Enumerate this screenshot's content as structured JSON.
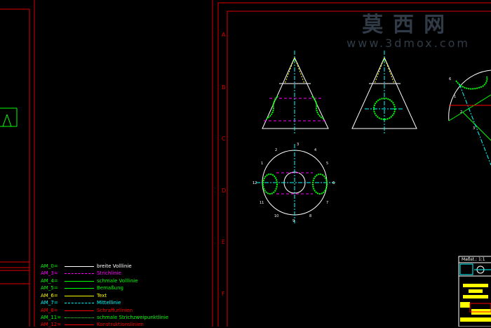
{
  "watermark": {
    "cn": "莫西网",
    "url": "www.3dmox.com"
  },
  "zones": [
    "A",
    "B",
    "C",
    "D",
    "E",
    "F"
  ],
  "legend": [
    {
      "code": "AM_0=",
      "label": "breite Volllinie",
      "code_color": "#00ff00",
      "label_color": "#ffffff",
      "line_color": "#ffffff",
      "style": "solid"
    },
    {
      "code": "AM_3=",
      "label": "Strichlinie",
      "code_color": "#ff00ff",
      "label_color": "#ff00ff",
      "line_color": "#ff00ff",
      "style": "dashed"
    },
    {
      "code": "AM_4=",
      "label": "schmale Volllinie",
      "code_color": "#00ff00",
      "label_color": "#00ff00",
      "line_color": "#00ff00",
      "style": "solid"
    },
    {
      "code": "AM_5=",
      "label": "Bemaßung",
      "code_color": "#00ff00",
      "label_color": "#00ff00",
      "line_color": "#00ff00",
      "style": "solid"
    },
    {
      "code": "AM_6=",
      "label": "Text",
      "code_color": "#ffff00",
      "label_color": "#ffff00",
      "line_color": "#ffff00",
      "style": "solid"
    },
    {
      "code": "AM_7=",
      "label": "Mittellinie",
      "code_color": "#00ffff",
      "label_color": "#00ffff",
      "line_color": "#00ffff",
      "style": "dashed"
    },
    {
      "code": "AM_8=",
      "label": "Schraffurlinien",
      "code_color": "#ff0000",
      "label_color": "#ff0000",
      "line_color": "#ff0000",
      "style": "solid"
    },
    {
      "code": "AM_11=",
      "label": "schmale Strichzweipunktlinie",
      "code_color": "#00ff00",
      "label_color": "#00ff00",
      "line_color": "#00ff00",
      "style": "dotted"
    },
    {
      "code": "AM_12=",
      "label": "Konstruktionslinien",
      "code_color": "#ff0000",
      "label_color": "#ff0000",
      "line_color": "#ff0000",
      "style": "solid"
    }
  ],
  "titleblock": {
    "scale_label": "Maßst.: 1:1"
  },
  "point_labels": {
    "circle": [
      "1",
      "2",
      "3",
      "4",
      "5",
      "6",
      "7",
      "8",
      "9",
      "10",
      "11",
      "12"
    ],
    "side": [
      "1",
      "2",
      "3",
      "6"
    ]
  }
}
